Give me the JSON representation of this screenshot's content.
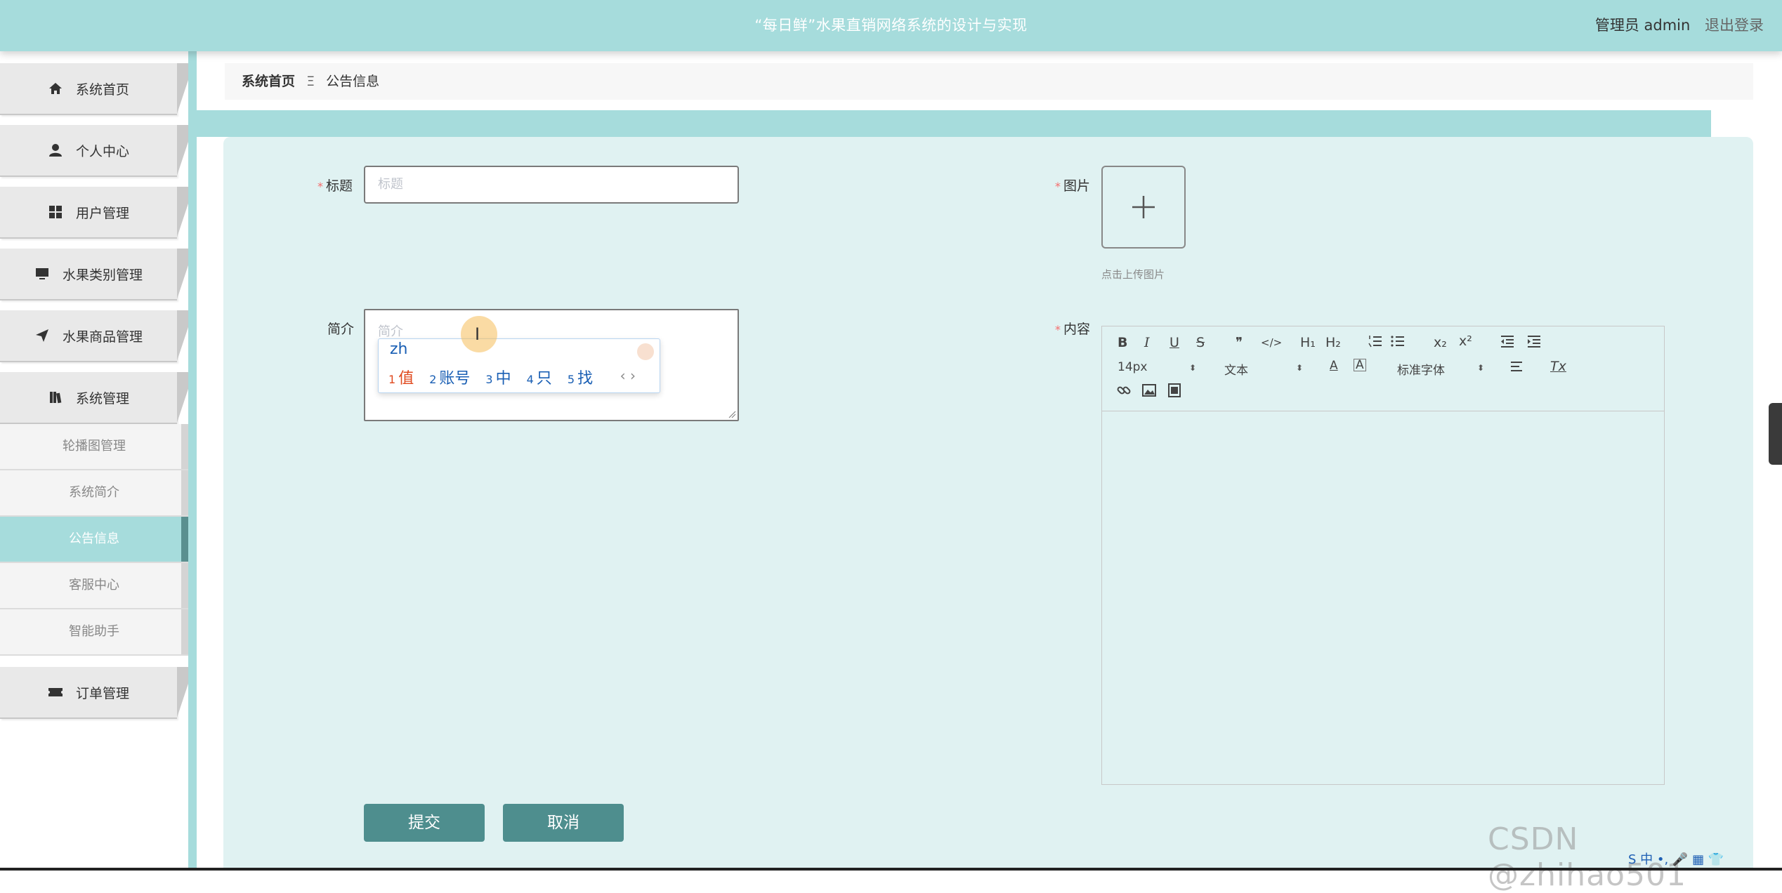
{
  "header": {
    "title": "“每日鲜”水果直销网络系统的设计与实现",
    "role": "管理员 admin",
    "logout": "退出登录"
  },
  "sidebar": {
    "items": [
      {
        "label": "系统首页",
        "icon": "home-icon"
      },
      {
        "label": "个人中心",
        "icon": "user-icon"
      },
      {
        "label": "用户管理",
        "icon": "grid-icon"
      },
      {
        "label": "水果类别管理",
        "icon": "monitor-icon"
      },
      {
        "label": "水果商品管理",
        "icon": "send-icon"
      },
      {
        "label": "系统管理",
        "icon": "books-icon"
      }
    ],
    "sub_items": [
      {
        "label": "轮播图管理"
      },
      {
        "label": "系统简介"
      },
      {
        "label": "公告信息"
      },
      {
        "label": "客服中心"
      },
      {
        "label": "智能助手"
      }
    ],
    "last_item": {
      "label": "订单管理",
      "icon": "ticket-icon"
    }
  },
  "breadcrumb": {
    "home": "系统首页",
    "separator": "Ξ",
    "current": "公告信息"
  },
  "form": {
    "title_label": "标题",
    "title_placeholder": "标题",
    "image_label": "图片",
    "upload_hint": "点击上传图片",
    "intro_label": "简介",
    "intro_placeholder": "简介",
    "content_label": "内容",
    "required_mark": "*",
    "submit": "提交",
    "cancel": "取消"
  },
  "ime": {
    "composition": "zh",
    "candidates": [
      {
        "n": "1",
        "text": "值"
      },
      {
        "n": "2",
        "text": "账号"
      },
      {
        "n": "3",
        "text": "中"
      },
      {
        "n": "4",
        "text": "只"
      },
      {
        "n": "5",
        "text": "找"
      }
    ],
    "arrows": "‹ ›"
  },
  "editor": {
    "bold": "B",
    "italic": "I",
    "underline": "U",
    "strike": "S",
    "quote": "❞",
    "code": "</>",
    "h1": "H₁",
    "h2": "H₂",
    "sub": "x₂",
    "sup": "x²",
    "size": "14px",
    "text_type": "文本",
    "font": "标准字体",
    "clear": "Tx"
  },
  "watermark": "CSDN @zhihao501",
  "tray": "S 中 •, 🎤 ▦ 👕"
}
